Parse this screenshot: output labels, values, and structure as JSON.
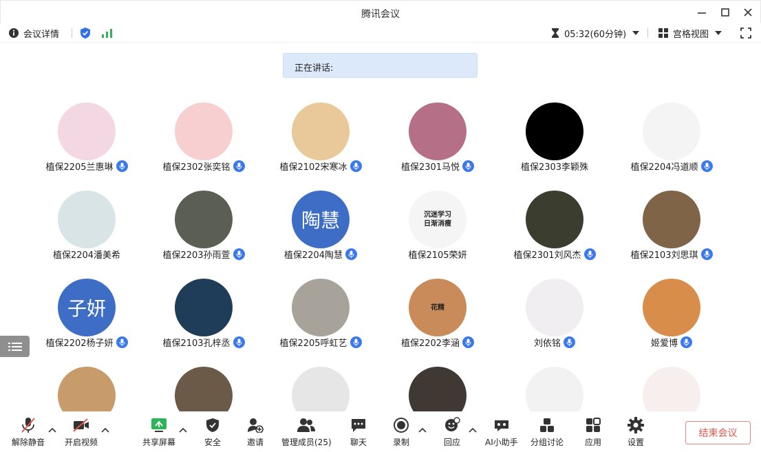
{
  "window": {
    "title": "腾讯会议"
  },
  "toolbar": {
    "meeting_info": "会议详情",
    "timer": "05:32(60分钟)",
    "view_mode": "宫格视图"
  },
  "speaking": {
    "label": "正在讲话:"
  },
  "participants": [
    {
      "name": "植保2205兰惠琳",
      "avatar_color": "#f3d7e2",
      "mic_on": true
    },
    {
      "name": "植保2302张奕铭",
      "avatar_color": "#f7cfd0",
      "mic_on": true
    },
    {
      "name": "植保2102宋寒冰",
      "avatar_color": "#e9c89a",
      "mic_on": true
    },
    {
      "name": "植保2301马悦",
      "avatar_color": "#b56f86",
      "mic_on": true
    },
    {
      "name": "植保2303李颖殊",
      "avatar_color": "#000000",
      "mic_on": false
    },
    {
      "name": "植保2204冯道顺",
      "avatar_color": "#f4f4f4",
      "mic_on": true
    },
    {
      "name": "植保2204潘美希",
      "avatar_color": "#d9e4e6",
      "mic_on": false
    },
    {
      "name": "植保2203孙雨萱",
      "avatar_color": "#5b5e52",
      "mic_on": true
    },
    {
      "name": "植保2204陶慧",
      "avatar_text": "陶慧",
      "mic_on": true
    },
    {
      "name": "植保2105荣妍",
      "avatar_color": "#f5f5f5",
      "avatar_caption": [
        "沉迷学习",
        "日渐消瘦"
      ],
      "mic_on": false
    },
    {
      "name": "植保2301刘风杰",
      "avatar_color": "#3b3d2f",
      "mic_on": true
    },
    {
      "name": "植保2103刘思琪",
      "avatar_color": "#7f6448",
      "mic_on": true
    },
    {
      "name": "植保2202杨子妍",
      "avatar_text": "子妍",
      "mic_on": true
    },
    {
      "name": "植保2103孔梓丞",
      "avatar_color": "#1f3c58",
      "mic_on": true
    },
    {
      "name": "植保2205呼虹艺",
      "avatar_color": "#a8a39a",
      "mic_on": true
    },
    {
      "name": "植保2202李涵",
      "avatar_color": "#c98b5a",
      "avatar_caption": [
        "花精"
      ],
      "mic_on": true
    },
    {
      "name": "刘依铭",
      "avatar_color": "#f1eef2",
      "mic_on": true
    },
    {
      "name": "姬爱博",
      "avatar_color": "#d98d4a",
      "mic_on": true
    },
    {
      "name": "",
      "avatar_color": "#c79b6a",
      "mic_on": false
    },
    {
      "name": "",
      "avatar_color": "#6b5a48",
      "mic_on": false
    },
    {
      "name": "",
      "avatar_color": "#e6e6e6",
      "mic_on": false
    },
    {
      "name": "",
      "avatar_color": "#403833",
      "mic_on": false
    },
    {
      "name": "",
      "avatar_color": "#f2f2f2",
      "mic_on": false
    },
    {
      "name": "",
      "avatar_color": "#f7eeee",
      "mic_on": false
    }
  ],
  "bottom": {
    "unmute": "解除静音",
    "start_video": "开启视频",
    "share_screen": "共享屏幕",
    "security": "安全",
    "invite": "邀请",
    "manage_members": "管理成员(25)",
    "chat": "聊天",
    "record": "录制",
    "replay": "回应",
    "ai_assistant": "AI小助手",
    "breakout": "分组讨论",
    "apps": "应用",
    "settings": "设置",
    "end_meeting": "结束会议"
  },
  "colors": {
    "accent": "#3a78f0",
    "danger": "#e2574c",
    "speaking_bg": "#dbe9fb",
    "text_avatar": "#3d6dc5"
  }
}
